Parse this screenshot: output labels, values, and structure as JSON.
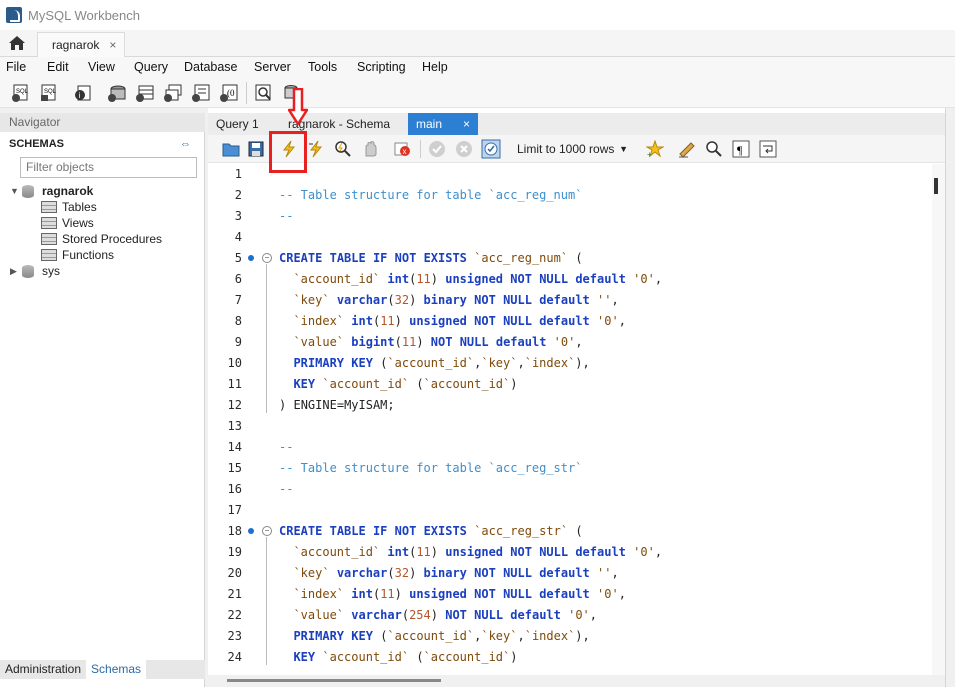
{
  "window": {
    "title": "MySQL Workbench"
  },
  "connection_tab": {
    "label": "ragnarok",
    "close": "×"
  },
  "menu": [
    "File",
    "Edit",
    "View",
    "Query",
    "Database",
    "Server",
    "Tools",
    "Scripting",
    "Help"
  ],
  "navigator": {
    "header": "Navigator",
    "schemas_title": "SCHEMAS",
    "filter_placeholder": "Filter objects",
    "tree": {
      "schema_1": "ragnarok",
      "tables": "Tables",
      "views": "Views",
      "procedures": "Stored Procedures",
      "functions": "Functions",
      "schema_2": "sys"
    },
    "bottom_tabs": [
      "Administration",
      "Schemas"
    ]
  },
  "doc_tabs": [
    "Query 1",
    "ragnarok - Schema",
    "main"
  ],
  "doc_tab_close": "×",
  "sql_toolbar": {
    "limit_label": "Limit to 1000 rows"
  },
  "colors": {
    "active_tab": "#2d7fd3",
    "highlight": "#e82020",
    "keyword": "#1a3fbf",
    "comment": "#3f8fcc"
  },
  "icons": [
    "open-file-icon",
    "save-icon",
    "execute-lightning-icon",
    "execute-current-icon",
    "explain-icon",
    "stop-icon",
    "toggle-error-icon",
    "commit-icon",
    "rollback-icon",
    "autocommit-icon",
    "beautify-icon",
    "find-icon",
    "invisible-chars-icon",
    "wrap-icon"
  ],
  "code_lines": [
    {
      "n": "1",
      "t": ""
    },
    {
      "n": "2",
      "t": "-- Table structure for table `acc_reg_num`"
    },
    {
      "n": "3",
      "t": "--"
    },
    {
      "n": "4",
      "t": ""
    },
    {
      "n": "5",
      "t": "CREATE TABLE IF NOT EXISTS `acc_reg_num` ("
    },
    {
      "n": "6",
      "t": "  `account_id` int(11) unsigned NOT NULL default '0',"
    },
    {
      "n": "7",
      "t": "  `key` varchar(32) binary NOT NULL default '',"
    },
    {
      "n": "8",
      "t": "  `index` int(11) unsigned NOT NULL default '0',"
    },
    {
      "n": "9",
      "t": "  `value` bigint(11) NOT NULL default '0',"
    },
    {
      "n": "10",
      "t": "  PRIMARY KEY (`account_id`,`key`,`index`),"
    },
    {
      "n": "11",
      "t": "  KEY `account_id` (`account_id`)"
    },
    {
      "n": "12",
      "t": ") ENGINE=MyISAM;"
    },
    {
      "n": "13",
      "t": ""
    },
    {
      "n": "14",
      "t": "--"
    },
    {
      "n": "15",
      "t": "-- Table structure for table `acc_reg_str`"
    },
    {
      "n": "16",
      "t": "--"
    },
    {
      "n": "17",
      "t": ""
    },
    {
      "n": "18",
      "t": "CREATE TABLE IF NOT EXISTS `acc_reg_str` ("
    },
    {
      "n": "19",
      "t": "  `account_id` int(11) unsigned NOT NULL default '0',"
    },
    {
      "n": "20",
      "t": "  `key` varchar(32) binary NOT NULL default '',"
    },
    {
      "n": "21",
      "t": "  `index` int(11) unsigned NOT NULL default '0',"
    },
    {
      "n": "22",
      "t": "  `value` varchar(254) NOT NULL default '0',"
    },
    {
      "n": "23",
      "t": "  PRIMARY KEY (`account_id`,`key`,`index`),"
    },
    {
      "n": "24",
      "t": "  KEY `account_id` (`account_id`)"
    }
  ]
}
